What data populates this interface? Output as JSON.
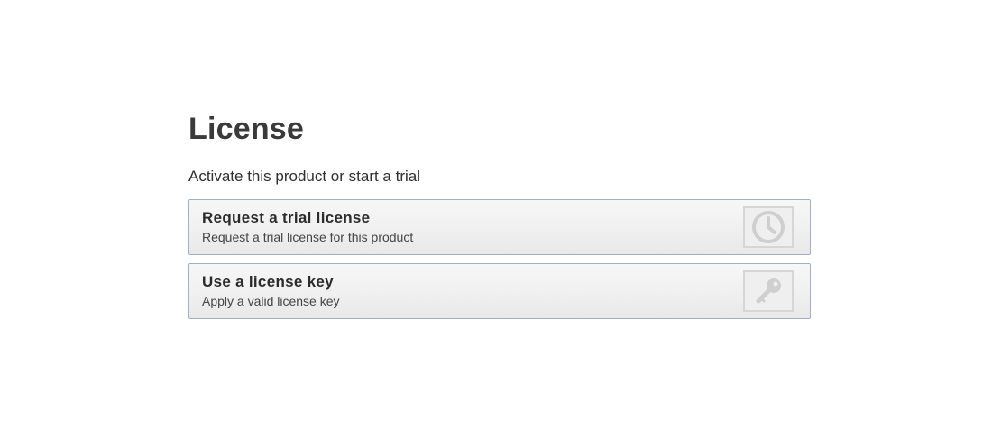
{
  "page": {
    "title": "License",
    "subtitle": "Activate this product or start a trial"
  },
  "options": [
    {
      "title": "Request a trial license",
      "description": "Request a trial license for this product",
      "icon": "clock-icon"
    },
    {
      "title": "Use a license key",
      "description": "Apply a valid license key",
      "icon": "key-icon"
    }
  ],
  "colors": {
    "card_border": "#9fb1c6",
    "card_background": "#efefef",
    "icon_color": "#cfcfcf"
  }
}
